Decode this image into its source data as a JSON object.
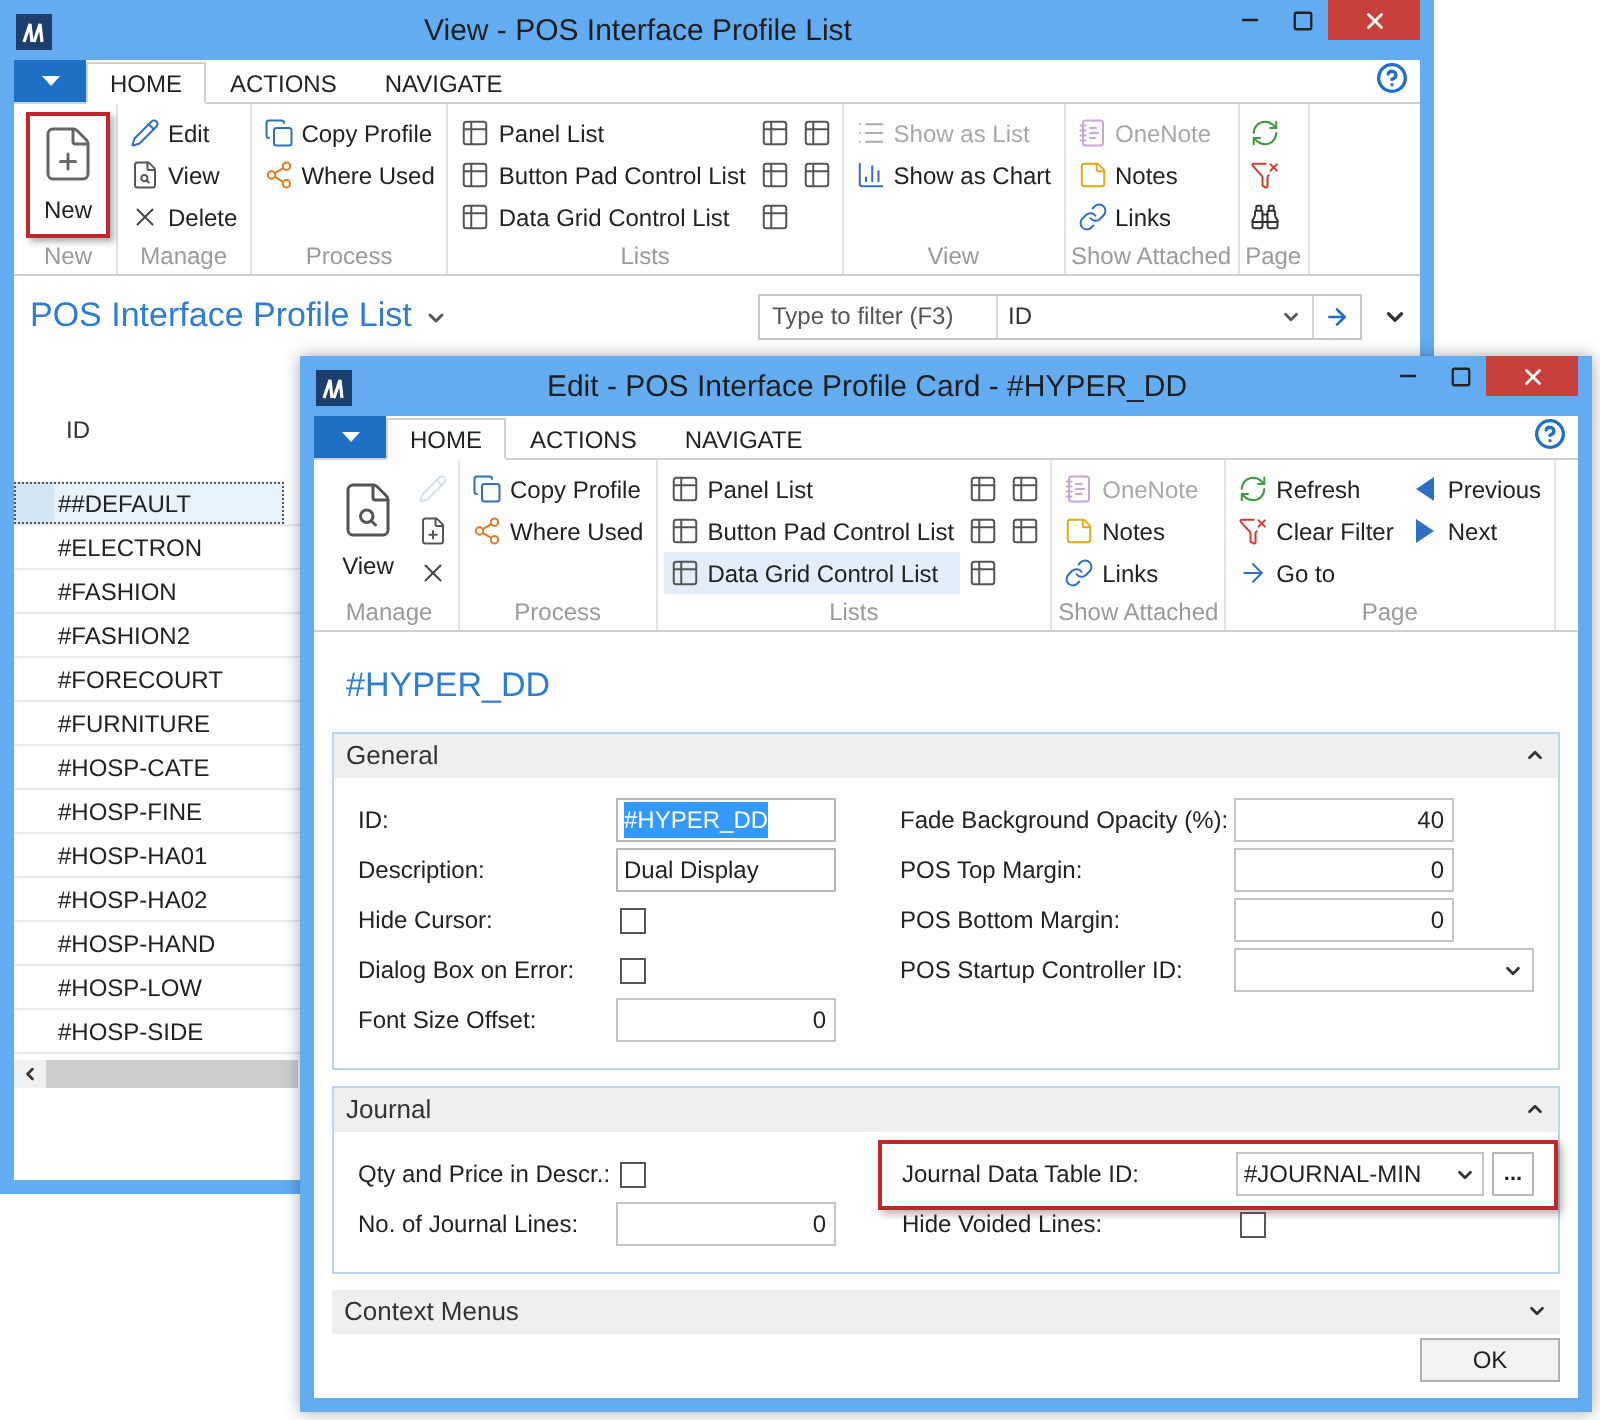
{
  "windows": [
    {
      "kind": "list",
      "title": "View - POS Interface Profile List",
      "tabs": [
        {
          "label": "HOME",
          "selected": true
        },
        {
          "label": "ACTIONS",
          "selected": false
        },
        {
          "label": "NAVIGATE",
          "selected": false
        }
      ],
      "ribbon": [
        {
          "label": "New",
          "buttons": [
            {
              "kind": "large",
              "label": "New",
              "disabled": false,
              "annotated": true
            }
          ]
        },
        {
          "label": "Manage",
          "buttons": [
            {
              "kind": "small",
              "label": "Edit",
              "disabled": false
            },
            {
              "kind": "small",
              "label": "View",
              "disabled": false
            },
            {
              "kind": "small",
              "label": "Delete",
              "disabled": false
            }
          ]
        },
        {
          "label": "Process",
          "buttons": [
            {
              "kind": "small",
              "label": "Copy Profile",
              "disabled": false
            },
            {
              "kind": "small",
              "label": "Where Used",
              "disabled": false
            }
          ]
        },
        {
          "label": "Lists",
          "buttons": [
            {
              "kind": "small",
              "label": "Panel List",
              "disabled": false
            },
            {
              "kind": "small",
              "label": "Button Pad Control List",
              "disabled": false
            },
            {
              "kind": "small",
              "label": "Data Grid Control List",
              "disabled": false
            },
            {
              "kind": "icon",
              "disabled": false
            },
            {
              "kind": "icon",
              "disabled": false
            },
            {
              "kind": "icon",
              "disabled": false
            },
            {
              "kind": "icon",
              "disabled": false
            },
            {
              "kind": "icon",
              "disabled": false
            }
          ]
        },
        {
          "label": "View",
          "buttons": [
            {
              "kind": "small",
              "label": "Show as List",
              "disabled": true
            },
            {
              "kind": "small",
              "label": "Show as Chart",
              "disabled": false
            }
          ]
        },
        {
          "label": "Show Attached",
          "buttons": [
            {
              "kind": "small",
              "label": "OneNote",
              "disabled": true
            },
            {
              "kind": "small",
              "label": "Notes",
              "disabled": false
            },
            {
              "kind": "small",
              "label": "Links",
              "disabled": false
            }
          ]
        },
        {
          "label": "Page",
          "buttons": [
            {
              "kind": "icon",
              "disabled": false
            },
            {
              "kind": "icon",
              "disabled": false
            },
            {
              "kind": "icon",
              "disabled": false
            }
          ]
        }
      ],
      "page_title": "POS Interface Profile List",
      "filter": {
        "placeholder": "Type to filter (F3)",
        "field": "ID"
      },
      "list": {
        "column": "ID",
        "rows": [
          {
            "id": "##DEFAULT",
            "selected": true
          },
          {
            "id": "#ELECTRON",
            "selected": false
          },
          {
            "id": "#FASHION",
            "selected": false
          },
          {
            "id": "#FASHION2",
            "selected": false
          },
          {
            "id": "#FORECOURT",
            "selected": false
          },
          {
            "id": "#FURNITURE",
            "selected": false
          },
          {
            "id": "#HOSP-CATE",
            "selected": false
          },
          {
            "id": "#HOSP-FINE",
            "selected": false
          },
          {
            "id": "#HOSP-HA01",
            "selected": false
          },
          {
            "id": "#HOSP-HA02",
            "selected": false
          },
          {
            "id": "#HOSP-HAND",
            "selected": false
          },
          {
            "id": "#HOSP-LOW",
            "selected": false
          },
          {
            "id": "#HOSP-SIDE",
            "selected": false
          }
        ]
      }
    },
    {
      "kind": "card",
      "title": "Edit - POS Interface Profile Card - #HYPER_DD",
      "tabs": [
        {
          "label": "HOME",
          "selected": true
        },
        {
          "label": "ACTIONS",
          "selected": false
        },
        {
          "label": "NAVIGATE",
          "selected": false
        }
      ],
      "ribbon": [
        {
          "label": "Manage",
          "buttons": [
            {
              "kind": "large",
              "label": "View",
              "disabled": false,
              "annotated": false
            },
            {
              "kind": "icon",
              "disabled": true
            },
            {
              "kind": "icon",
              "disabled": false
            },
            {
              "kind": "icon",
              "disabled": false
            }
          ]
        },
        {
          "label": "Process",
          "buttons": [
            {
              "kind": "small",
              "label": "Copy Profile",
              "disabled": false
            },
            {
              "kind": "small",
              "label": "Where Used",
              "disabled": false
            }
          ]
        },
        {
          "label": "Lists",
          "buttons": [
            {
              "kind": "small",
              "label": "Panel List",
              "disabled": false
            },
            {
              "kind": "small",
              "label": "Button Pad Control List",
              "disabled": false
            },
            {
              "kind": "small",
              "label": "Data Grid Control List",
              "disabled": false,
              "highlighted": true
            },
            {
              "kind": "icon",
              "disabled": false
            },
            {
              "kind": "icon",
              "disabled": false
            },
            {
              "kind": "icon",
              "disabled": false
            },
            {
              "kind": "icon",
              "disabled": false
            },
            {
              "kind": "icon",
              "disabled": false
            }
          ]
        },
        {
          "label": "Show Attached",
          "buttons": [
            {
              "kind": "small",
              "label": "OneNote",
              "disabled": true
            },
            {
              "kind": "small",
              "label": "Notes",
              "disabled": false
            },
            {
              "kind": "small",
              "label": "Links",
              "disabled": false
            }
          ]
        },
        {
          "label": "Page",
          "buttons": [
            {
              "kind": "small",
              "label": "Refresh",
              "disabled": false
            },
            {
              "kind": "small",
              "label": "Clear Filter",
              "disabled": false
            },
            {
              "kind": "small",
              "label": "Go to",
              "disabled": false
            },
            {
              "kind": "small",
              "label": "Previous",
              "disabled": false
            },
            {
              "kind": "small",
              "label": "Next",
              "disabled": false
            }
          ]
        }
      ],
      "page_title": "#HYPER_DD",
      "sections": [
        {
          "title": "General",
          "expanded": true,
          "left": [
            {
              "kind": "text",
              "label": "ID:",
              "value": "#HYPER_DD",
              "text_selected": true
            },
            {
              "kind": "text",
              "label": "Description:",
              "value": "Dual Display",
              "text_selected": false
            },
            {
              "kind": "checkbox",
              "label": "Hide Cursor:",
              "checked": false
            },
            {
              "kind": "checkbox",
              "label": "Dialog Box on Error:",
              "checked": false
            },
            {
              "kind": "number",
              "label": "Font Size Offset:",
              "value": "0"
            }
          ],
          "right": [
            {
              "kind": "number",
              "label": "Fade Background Opacity (%):",
              "value": "40"
            },
            {
              "kind": "number",
              "label": "POS Top Margin:",
              "value": "0"
            },
            {
              "kind": "number",
              "label": "POS Bottom Margin:",
              "value": "0"
            },
            {
              "kind": "select",
              "label": "POS Startup Controller ID:"
            }
          ]
        },
        {
          "title": "Journal",
          "expanded": true,
          "left": [
            {
              "kind": "checkbox",
              "label": "Qty and Price in Descr.:",
              "checked": false
            },
            {
              "kind": "number",
              "label": "No. of Journal Lines:",
              "value": "0"
            }
          ],
          "right": [
            {
              "kind": "lookup",
              "label": "Journal Data Table ID:",
              "value": "#JOURNAL-MIN",
              "button": "...",
              "annotated": true
            },
            {
              "kind": "checkbox",
              "label": "Hide Voided Lines:",
              "checked": false
            }
          ]
        },
        {
          "title": "Context Menus",
          "expanded": false
        }
      ],
      "buttons": [
        "OK"
      ]
    }
  ]
}
